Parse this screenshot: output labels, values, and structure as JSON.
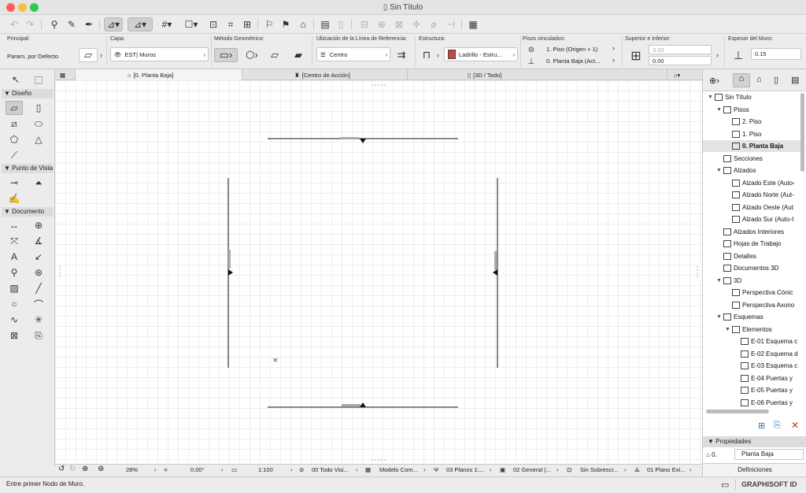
{
  "window": {
    "title": "Sin Título"
  },
  "infobox": {
    "principal": {
      "label": "Principal:",
      "value": "Param. por Defecto"
    },
    "capa": {
      "label": "Capa:",
      "value": "EST| Muros"
    },
    "metodo": {
      "label": "Método Geométrico:"
    },
    "ubicacion": {
      "label": "Ubicación de la Línea de Referencia:",
      "value": "Centro"
    },
    "estructura": {
      "label": "Estructura:",
      "value": "Ladrillo - Estru..."
    },
    "pisos": {
      "label": "Pisos vinculados:",
      "top": "1. Piso (Origen + 1)",
      "bottom": "0. Planta Baja (Act..."
    },
    "superior": {
      "label": "Superior e Inferior:",
      "top": "3.00",
      "bottom": "0.00"
    },
    "espesor": {
      "label": "Espesor del Muro:",
      "value": "0.15"
    }
  },
  "toolbox": {
    "sections": [
      "Diseño",
      "Punto de Vista",
      "Documento"
    ]
  },
  "tabs": [
    "[0. Planta Baja]",
    "[Centro de Acción]",
    "[3D / Todo]"
  ],
  "statusbar": {
    "zoom": "28%",
    "angle": "0.00°",
    "scale": "1:100",
    "layers": "00 Todo Visi...",
    "model": "Modelo Com...",
    "pen": "03 Planos 1:...",
    "general": "02 General (...",
    "override": "Sin Sobrescr...",
    "reno": "01 Plano Exi..."
  },
  "footer": {
    "prompt": "Entre primer Nodo de Muro.",
    "brand": "GRAPHISOFT ID"
  },
  "navigator": {
    "items": [
      {
        "label": "Sin Título",
        "level": 0,
        "tri": "▼"
      },
      {
        "label": "Pisos",
        "level": 1,
        "tri": "▼"
      },
      {
        "label": "2. Piso",
        "level": 2,
        "tri": ""
      },
      {
        "label": "1. Piso",
        "level": 2,
        "tri": ""
      },
      {
        "label": "0. Planta Baja",
        "level": 2,
        "tri": "",
        "selected": true
      },
      {
        "label": "Secciones",
        "level": 1,
        "tri": ""
      },
      {
        "label": "Alzados",
        "level": 1,
        "tri": "▼"
      },
      {
        "label": "Alzado Este (Auto-",
        "level": 2,
        "tri": ""
      },
      {
        "label": "Alzado Norte (Aut-",
        "level": 2,
        "tri": ""
      },
      {
        "label": "Alzado Oeste (Aut",
        "level": 2,
        "tri": ""
      },
      {
        "label": "Alzado Sur (Auto-I",
        "level": 2,
        "tri": ""
      },
      {
        "label": "Alzados Interiores",
        "level": 1,
        "tri": ""
      },
      {
        "label": "Hojas de Trabajo",
        "level": 1,
        "tri": ""
      },
      {
        "label": "Detalles",
        "level": 1,
        "tri": ""
      },
      {
        "label": "Documentos 3D",
        "level": 1,
        "tri": ""
      },
      {
        "label": "3D",
        "level": 1,
        "tri": "▼"
      },
      {
        "label": "Perspectiva Cónic",
        "level": 2,
        "tri": ""
      },
      {
        "label": "Perspectiva Axono",
        "level": 2,
        "tri": ""
      },
      {
        "label": "Esquemas",
        "level": 1,
        "tri": "▼"
      },
      {
        "label": "Elementos",
        "level": 2,
        "tri": "▼"
      },
      {
        "label": "E-01 Esquema c",
        "level": 3,
        "tri": ""
      },
      {
        "label": "E-02 Esquema d",
        "level": 3,
        "tri": ""
      },
      {
        "label": "E-03 Esquema c",
        "level": 3,
        "tri": ""
      },
      {
        "label": "E-04 Puertas y",
        "level": 3,
        "tri": ""
      },
      {
        "label": "E-05 Puertas y",
        "level": 3,
        "tri": ""
      },
      {
        "label": "E-06 Puertas y",
        "level": 3,
        "tri": ""
      }
    ],
    "properties": {
      "header": "Propiedades",
      "id": "0.",
      "name": "Planta Baja",
      "button": "Definiciones"
    }
  }
}
